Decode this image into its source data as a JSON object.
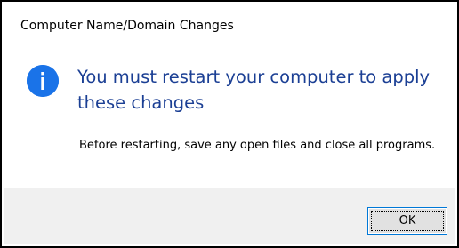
{
  "dialog": {
    "title": "Computer Name/Domain Changes",
    "heading": "You must restart your computer to apply these changes",
    "message": "Before restarting, save any open files and close all programs.",
    "icon": "info-icon",
    "ok_label": "OK"
  },
  "colors": {
    "accent": "#1a73e8",
    "heading": "#1b3f94",
    "footer_bg": "#f0f0f0",
    "button_bg": "#e1e1e1",
    "button_border": "#0078d7"
  }
}
